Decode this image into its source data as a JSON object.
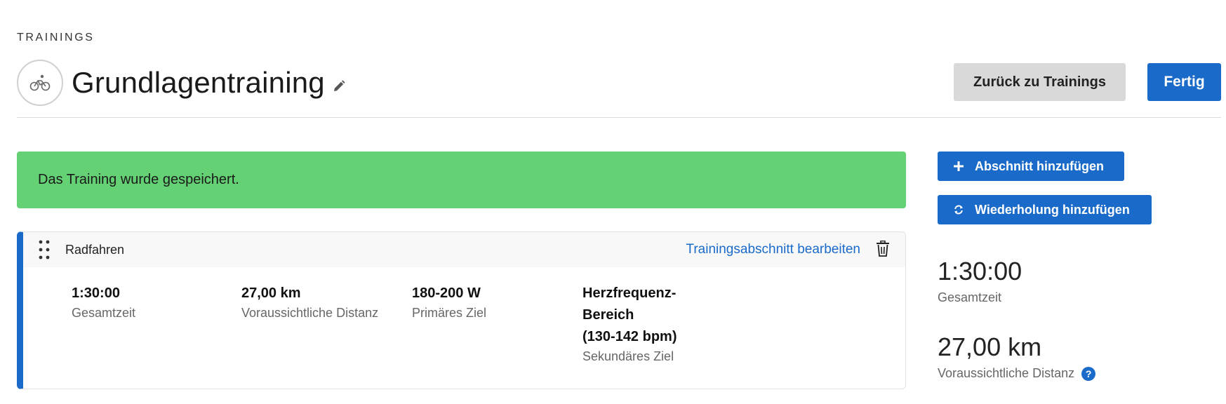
{
  "breadcrumb": {
    "label": "TRAININGS"
  },
  "header": {
    "title": "Grundlagentraining",
    "sport_icon": "cycling-icon",
    "edit_icon": "pencil-icon"
  },
  "actions": {
    "back_label": "Zurück zu Trainings",
    "done_label": "Fertig"
  },
  "alert": {
    "message": "Das Training wurde gespeichert."
  },
  "step": {
    "name": "Radfahren",
    "edit_link": "Trainingsabschnitt bearbeiten",
    "metrics": [
      {
        "value": "1:30:00",
        "label": "Gesamtzeit"
      },
      {
        "value": "27,00 km",
        "label": "Voraussichtliche Distanz"
      },
      {
        "value": "180-200 W",
        "label": "Primäres Ziel"
      },
      {
        "value_line1": "Herzfrequenz-",
        "value_line2": "Bereich",
        "value_line3": "(130-142 bpm)",
        "label": "Sekundäres Ziel"
      }
    ]
  },
  "sidebar": {
    "add_step_label": "Abschnitt hinzufügen",
    "add_repeat_label": "Wiederholung hinzufügen",
    "summary": [
      {
        "value": "1:30:00",
        "label": "Gesamtzeit"
      },
      {
        "value": "27,00 km",
        "label": "Voraussichtliche Distanz"
      }
    ],
    "help_glyph": "?"
  },
  "colors": {
    "primary": "#1a6bc9",
    "success": "#63d174",
    "secondary_button": "#d9d9d9"
  }
}
